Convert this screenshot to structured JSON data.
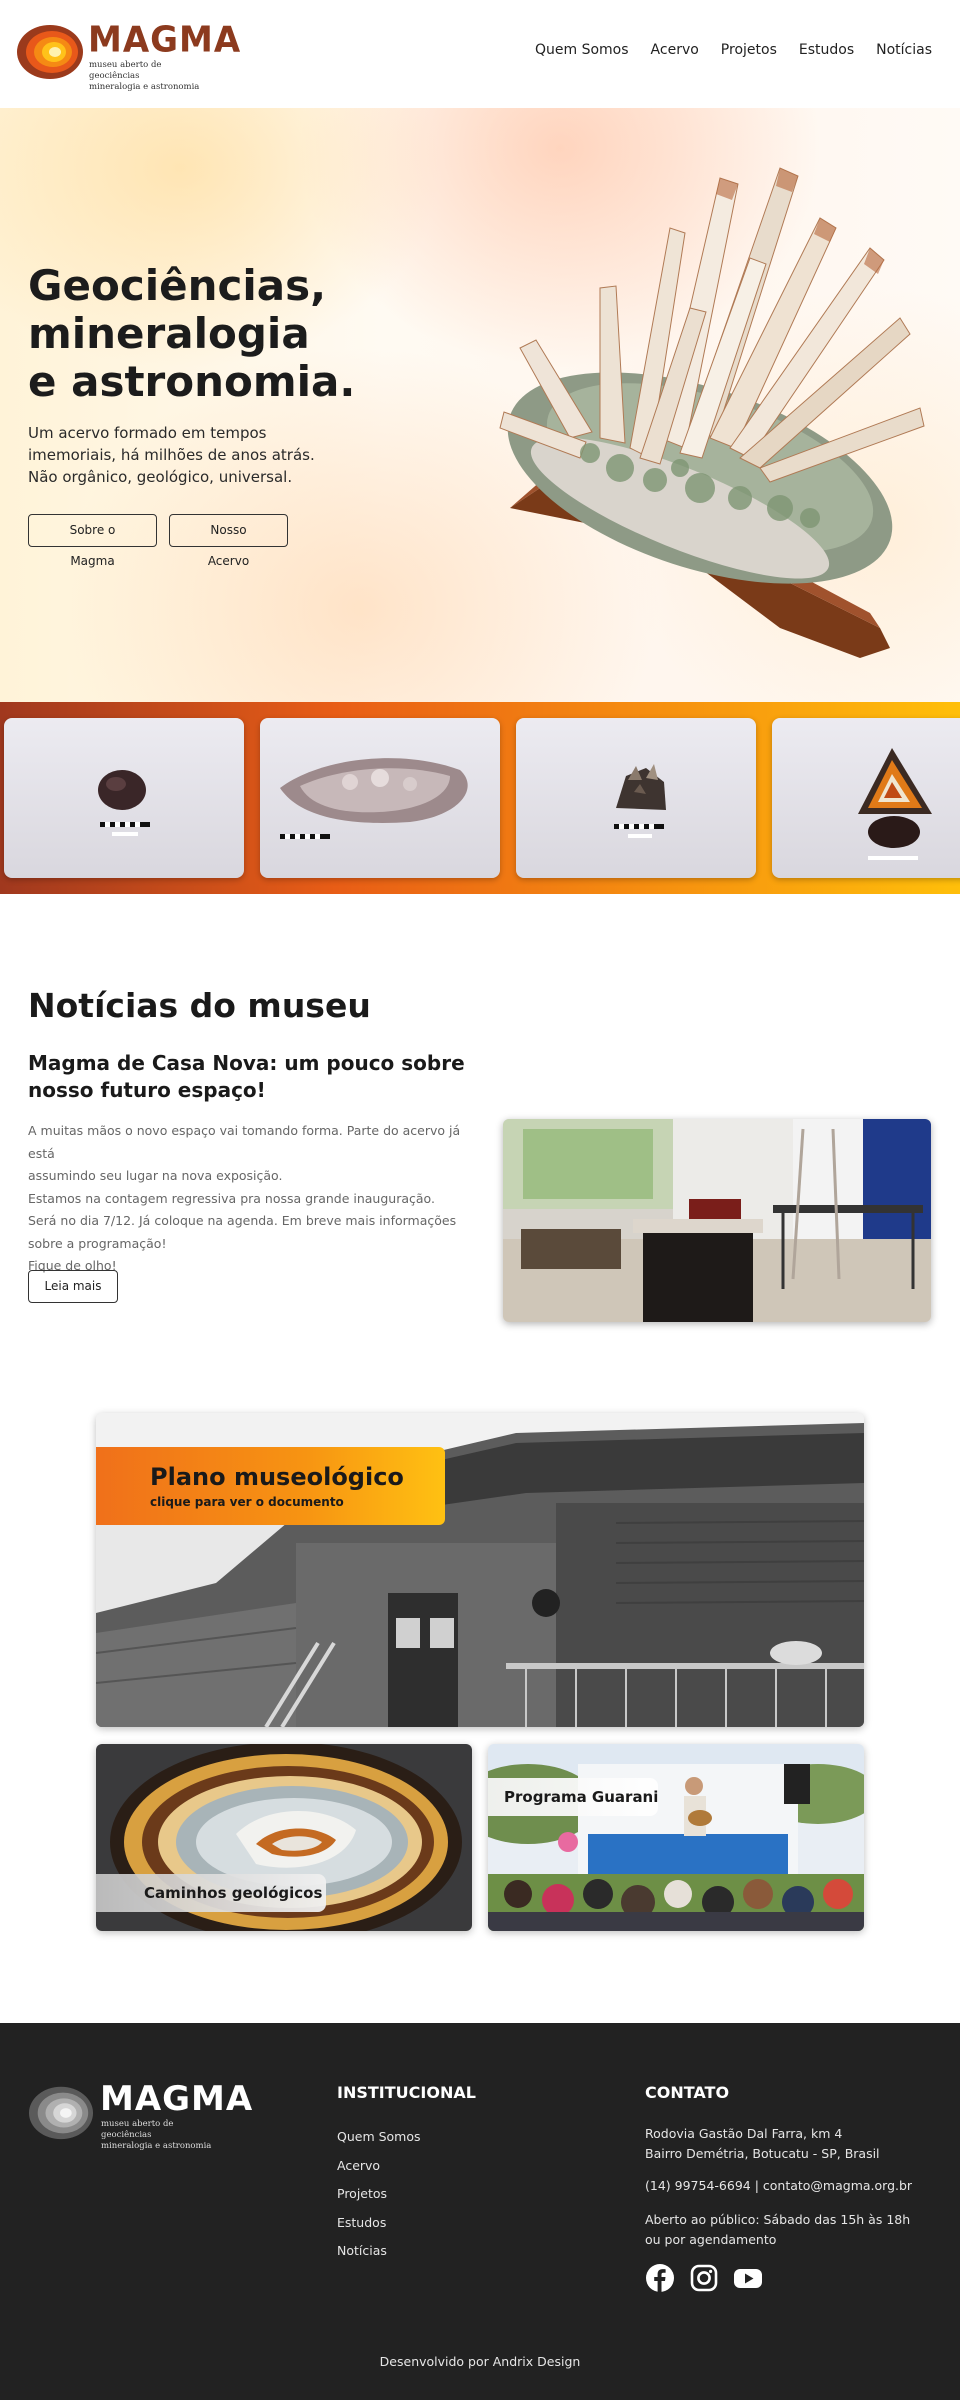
{
  "header": {
    "logo_word": "MAGMA",
    "logo_tagline_1": "museu aberto de geociências",
    "logo_tagline_2": "mineralogia e astronomia",
    "nav": [
      "Quem Somos",
      "Acervo",
      "Projetos",
      "Estudos",
      "Notícias"
    ]
  },
  "hero": {
    "title_1": "Geociências,",
    "title_2": "mineralogia",
    "title_3": "e astronomia.",
    "text_1": "Um acervo formado em tempos",
    "text_2": "imemoriais, há milhões de anos atrás.",
    "text_3": "Não orgânico, geológico, universal.",
    "button_1": "Sobre o Magma",
    "button_2": "Nosso Acervo"
  },
  "news": {
    "heading": "Notícias do museu",
    "title": "Magma de Casa Nova: um pouco sobre nosso futuro espaço!",
    "body": [
      "A muitas mãos o novo espaço vai tomando forma. Parte do acervo já está",
      "assumindo seu lugar na nova exposição.",
      "Estamos na contagem regressiva pra nossa grande inauguração.",
      "Será no dia 7/12. Já coloque na agenda. Em breve mais informações",
      "sobre a programação!",
      "Fique de olho!"
    ],
    "button": "Leia mais"
  },
  "cards": {
    "plano_title": "Plano museológico",
    "plano_sub": "clique para ver o documento",
    "caminhos": "Caminhos geológicos",
    "guarani": "Programa Guarani"
  },
  "footer": {
    "logo_word": "MAGMA",
    "logo_tagline_1": "museu aberto de geociências",
    "logo_tagline_2": "mineralogia e astronomia",
    "inst_title": "INSTITUCIONAL",
    "links": [
      "Quem Somos",
      "Acervo",
      "Projetos",
      "Estudos",
      "Notícias"
    ],
    "contact_title": "CONTATO",
    "address_1": "Rodovia Gastão Dal Farra, km 4",
    "address_2": "Bairro Demétria, Botucatu - SP, Brasil",
    "phone_email": "(14) 99754-6694 | contato@magma.org.br",
    "hours_1": "Aberto ao público: Sábado das 15h às 18h",
    "hours_2": "ou por agendamento",
    "social": [
      "facebook-icon",
      "instagram-icon",
      "youtube-icon"
    ],
    "credit": "Desenvolvido por Andrix Design"
  },
  "colors": {
    "brand": "#8c3a1e",
    "strip_start": "#a0381e",
    "strip_end": "#ffbf0a",
    "footer_bg": "#222222"
  }
}
